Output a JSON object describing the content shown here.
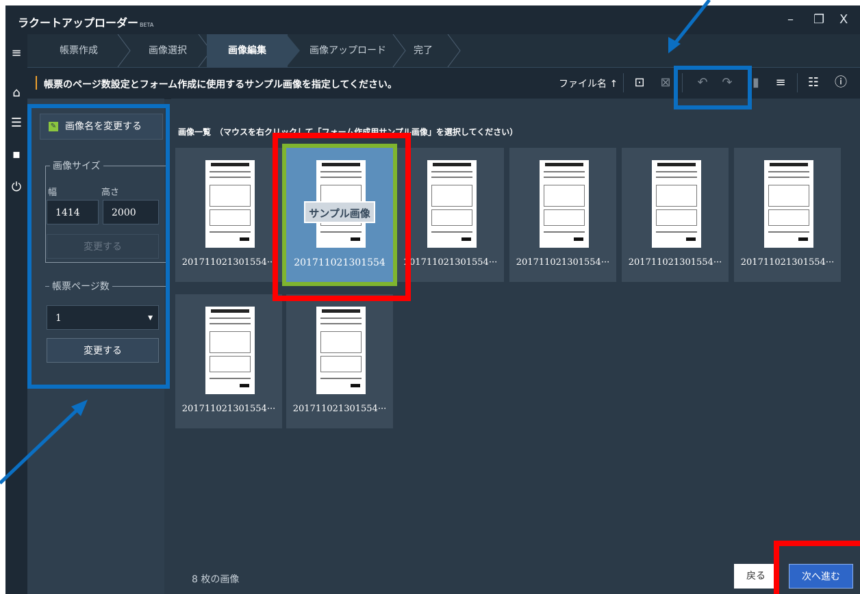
{
  "app": {
    "title": "ラクートアップローダー",
    "beta": "BETA"
  },
  "window": {
    "minimize": "–",
    "maximize": "❐",
    "close": "X"
  },
  "steps": [
    "帳票作成",
    "画像選択",
    "画像編集",
    "画像アップロード",
    "完了"
  ],
  "active_step": "画像編集",
  "toolbar": {
    "instruction": "帳票のページ数設定とフォーム作成に使用するサンプル画像を指定してください。",
    "sort_label": "ファイル名",
    "sort_icon": "arrow-up-icon"
  },
  "left_panel": {
    "rename_label": "画像名を変更する",
    "size_group": "画像サイズ",
    "width_label": "幅",
    "height_label": "高さ",
    "width_value": "1414",
    "height_value": "2000",
    "size_change": "変更する",
    "pages_group": "帳票ページ数",
    "pages_value": "1",
    "pages_change": "変更する"
  },
  "main": {
    "list_title": "画像一覧　（マウスを右クリックして「フォーム作成用サンプル画像」を選択してください）",
    "sample_badge": "サンプル画像",
    "images": [
      {
        "name": "201711021301554···"
      },
      {
        "name": "201711021301554"
      },
      {
        "name": "201711021301554···"
      },
      {
        "name": "201711021301554···"
      },
      {
        "name": "201711021301554···"
      },
      {
        "name": "201711021301554···"
      },
      {
        "name": "201711021301554···"
      },
      {
        "name": "201711021301554···"
      }
    ],
    "count": "8 枚の画像"
  },
  "footer": {
    "back": "戻る",
    "next": "次へ進む"
  },
  "colors": {
    "annotation_blue": "#0b6fc2",
    "annotation_red": "#ff0000",
    "selection_green": "#7fb52f"
  }
}
